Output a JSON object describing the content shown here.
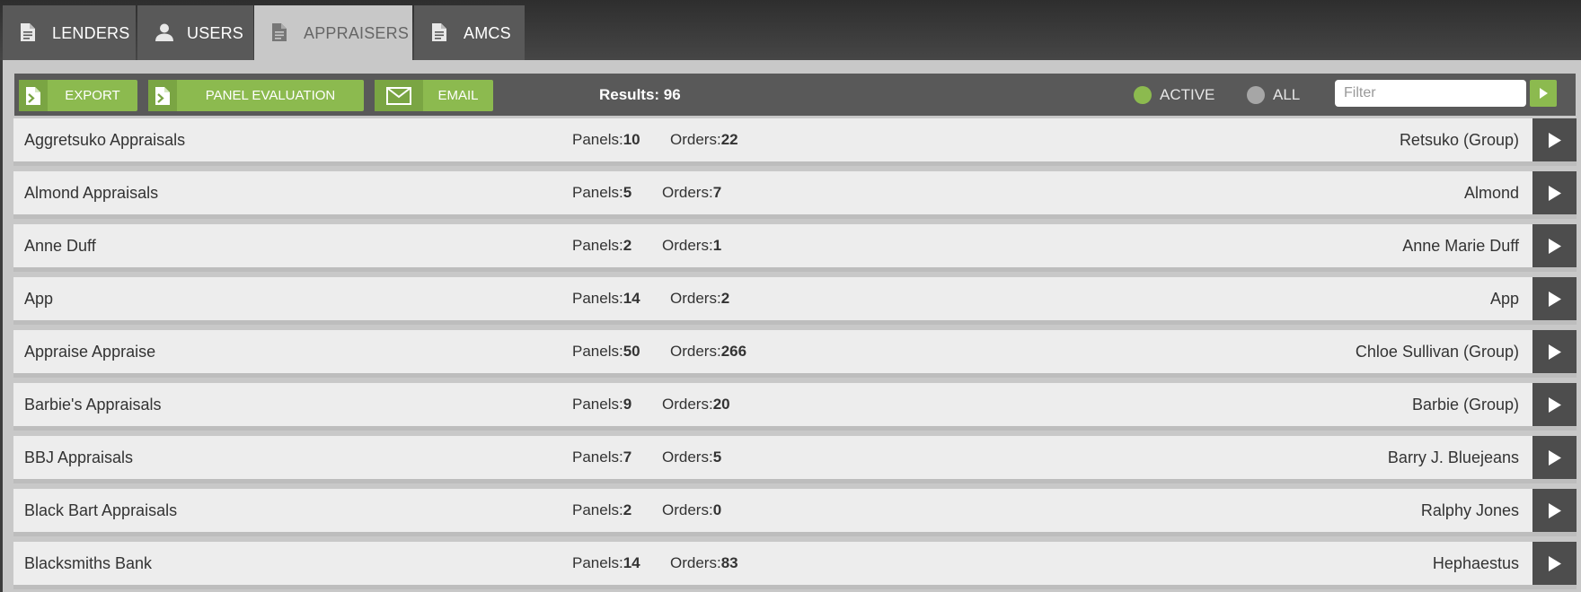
{
  "tabs": [
    {
      "label": "LENDERS",
      "icon": "document-icon",
      "active": false
    },
    {
      "label": "USERS",
      "icon": "user-icon",
      "active": false
    },
    {
      "label": "APPRAISERS",
      "icon": "document-icon",
      "active": true
    },
    {
      "label": "AMCS",
      "icon": "document-icon",
      "active": false
    }
  ],
  "toolbar": {
    "export_label": "EXPORT",
    "panel_evaluation_label": "PANEL EVALUATION",
    "email_label": "EMAIL",
    "results_text": "Results: 96",
    "active_label": "ACTIVE",
    "all_label": "ALL",
    "filter_placeholder": "Filter"
  },
  "colors": {
    "accent_green": "#8cba4f",
    "tab_bar": "#3c3c3c",
    "toolbar": "#595959",
    "row": "#ededed"
  },
  "labels": {
    "panels": "Panels:",
    "orders": "Orders:"
  },
  "rows": [
    {
      "name": "Aggretsuko Appraisals",
      "panels": "10",
      "orders": "22",
      "contact": "Retsuko (Group)"
    },
    {
      "name": "Almond Appraisals",
      "panels": "5",
      "orders": "7",
      "contact": "Almond"
    },
    {
      "name": "Anne Duff",
      "panels": "2",
      "orders": "1",
      "contact": "Anne Marie Duff"
    },
    {
      "name": "App",
      "panels": "14",
      "orders": "2",
      "contact": "App"
    },
    {
      "name": "Appraise Appraise",
      "panels": "50",
      "orders": "266",
      "contact": "Chloe Sullivan (Group)"
    },
    {
      "name": "Barbie's Appraisals",
      "panels": "9",
      "orders": "20",
      "contact": "Barbie (Group)"
    },
    {
      "name": "BBJ Appraisals",
      "panels": "7",
      "orders": "5",
      "contact": "Barry J. Bluejeans"
    },
    {
      "name": "Black Bart Appraisals",
      "panels": "2",
      "orders": "0",
      "contact": "Ralphy Jones"
    },
    {
      "name": "Blacksmiths Bank",
      "panels": "14",
      "orders": "83",
      "contact": "Hephaestus"
    }
  ]
}
